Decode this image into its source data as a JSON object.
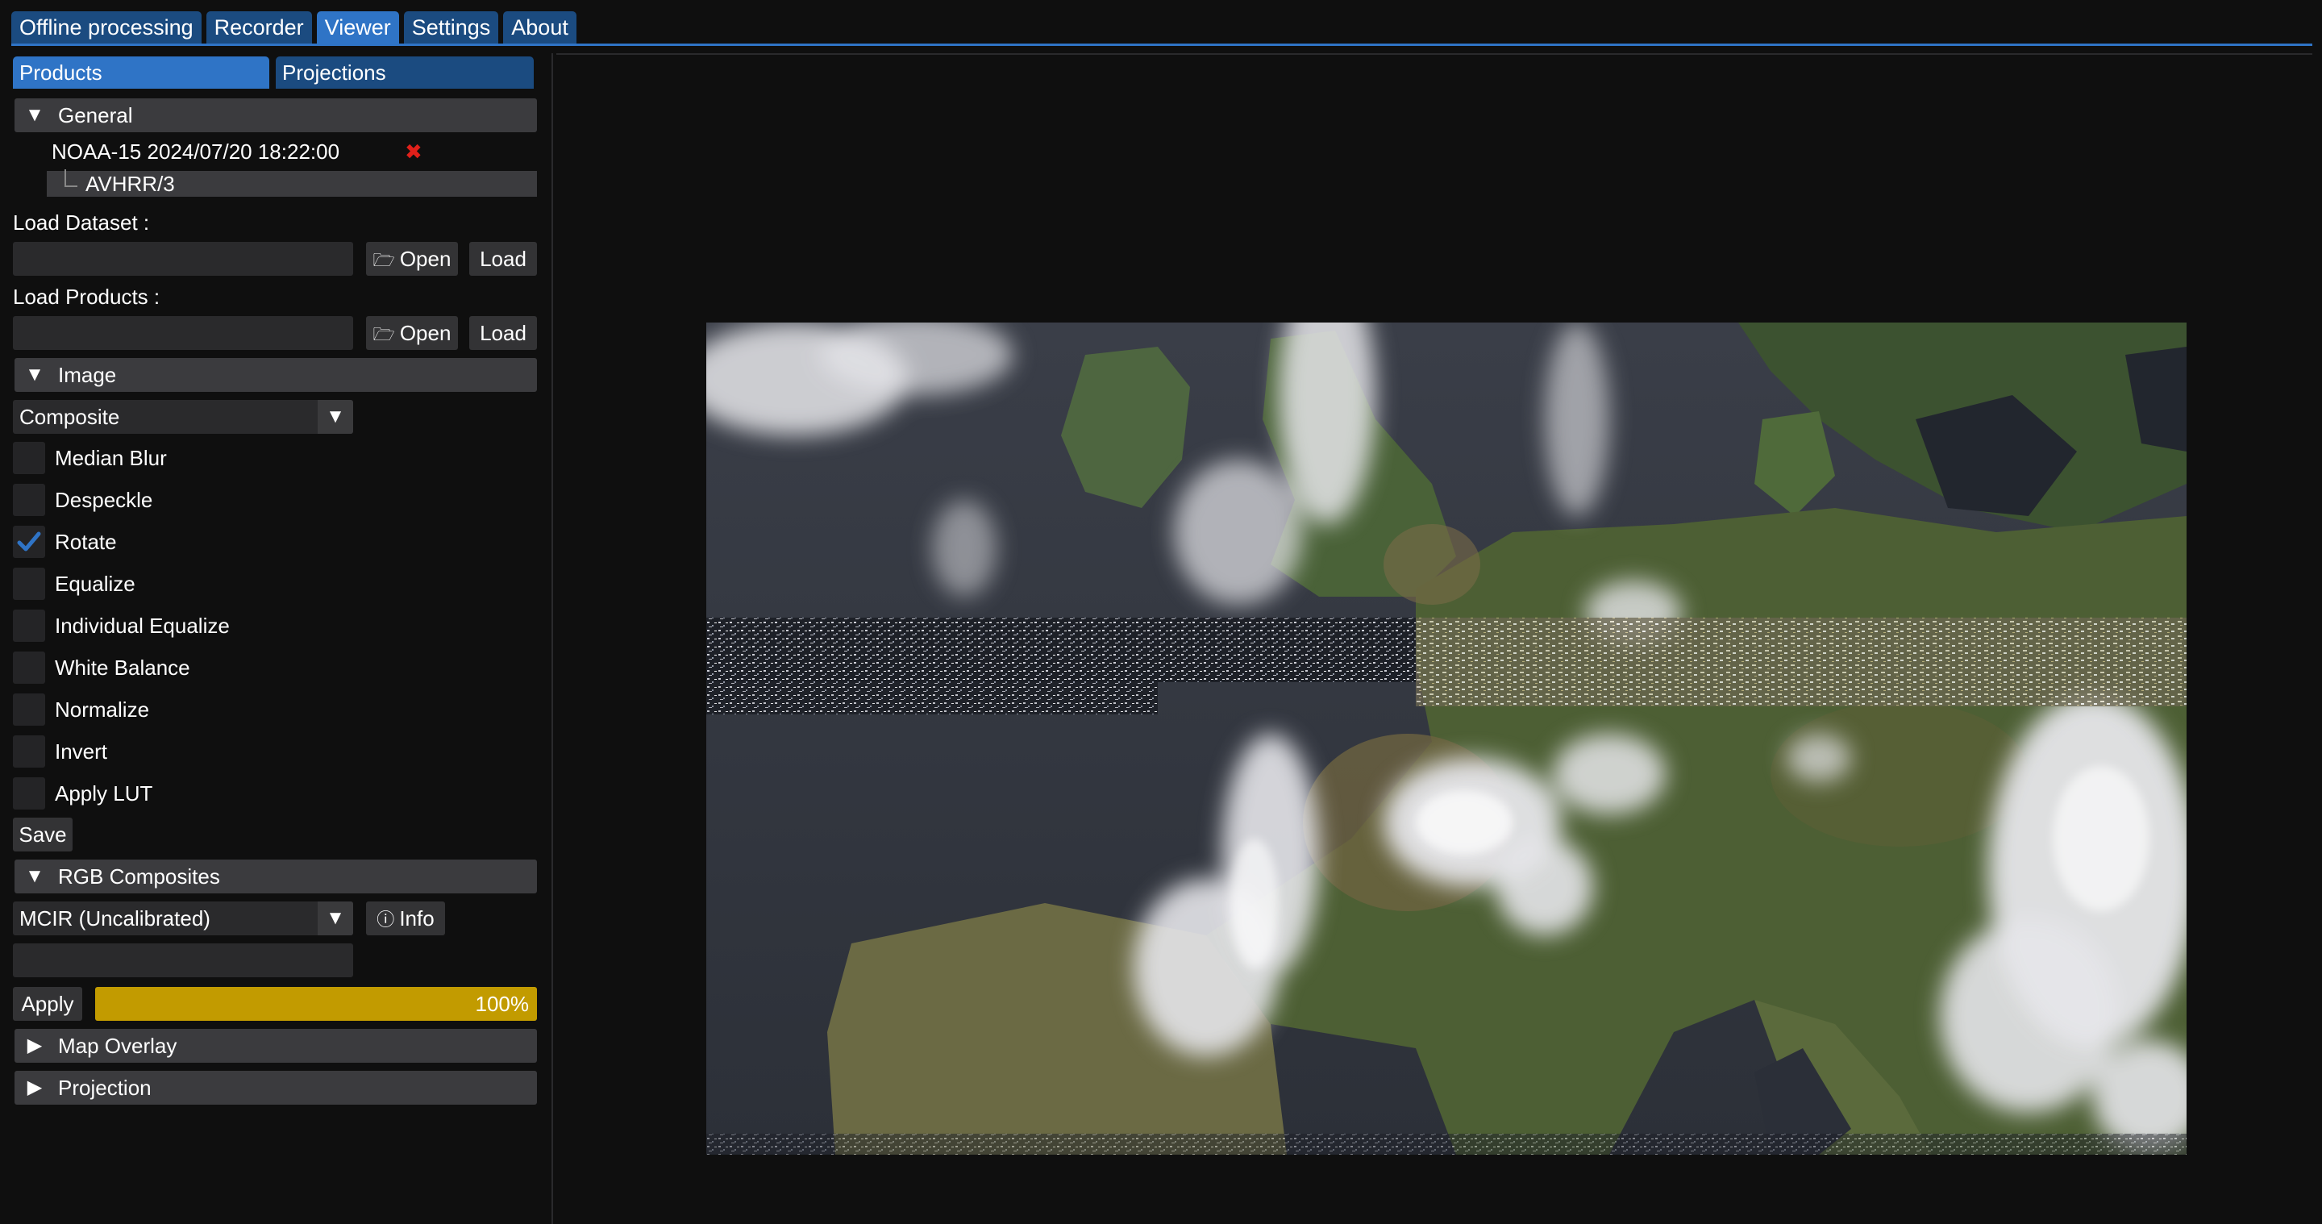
{
  "main_tabs": [
    {
      "label": "Offline processing",
      "active": false
    },
    {
      "label": "Recorder",
      "active": false
    },
    {
      "label": "Viewer",
      "active": true
    },
    {
      "label": "Settings",
      "active": false
    },
    {
      "label": "About",
      "active": false
    }
  ],
  "sub_tabs": {
    "products": "Products",
    "projections": "Projections"
  },
  "general": {
    "title": "General",
    "dataset_name": "NOAA-15 2024/07/20 18:22:00",
    "instrument": "AVHRR/3"
  },
  "load_dataset": {
    "label": "Load Dataset :",
    "value": "",
    "open_label": "Open",
    "load_label": "Load"
  },
  "load_products": {
    "label": "Load Products :",
    "value": "",
    "open_label": "Open",
    "load_label": "Load"
  },
  "image": {
    "title": "Image",
    "mode": "Composite",
    "options": [
      {
        "label": "Median Blur",
        "checked": false
      },
      {
        "label": "Despeckle",
        "checked": false
      },
      {
        "label": "Rotate",
        "checked": true
      },
      {
        "label": "Equalize",
        "checked": false
      },
      {
        "label": "Individual Equalize",
        "checked": false
      },
      {
        "label": "White Balance",
        "checked": false
      },
      {
        "label": "Normalize",
        "checked": false
      },
      {
        "label": "Invert",
        "checked": false
      },
      {
        "label": "Apply LUT",
        "checked": false
      }
    ],
    "save_label": "Save"
  },
  "rgb": {
    "title": "RGB Composites",
    "selected": "MCIR (Uncalibrated)",
    "info_label": "Info",
    "expression": "",
    "apply_label": "Apply",
    "progress_fraction": 1.0,
    "progress_text": "100%"
  },
  "map_overlay": {
    "title": "Map Overlay"
  },
  "projection": {
    "title": "Projection"
  },
  "colors": {
    "tab_active": "#2f74c6",
    "tab_inactive": "#1b4b80",
    "progress": "#c29b00",
    "check": "#2f74c6",
    "remove": "#e0201a"
  }
}
